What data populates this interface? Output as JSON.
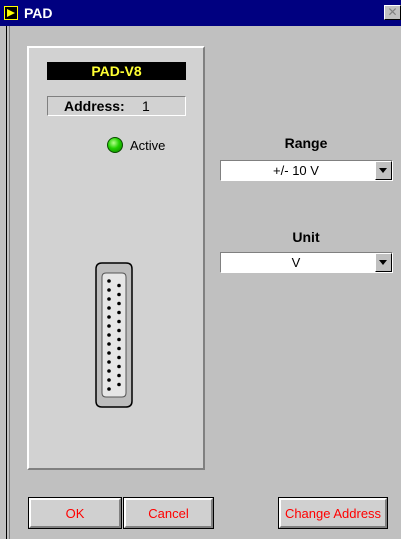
{
  "window": {
    "title": "PAD",
    "close_glyph": "✕"
  },
  "device": {
    "name": "PAD-V8",
    "address_label": "Address:",
    "address_value": "1",
    "status_label": "Active",
    "status_color": "#22d100",
    "connector_icon": "db25-connector-icon"
  },
  "range": {
    "label": "Range",
    "value": "+/- 10 V"
  },
  "unit": {
    "label": "Unit",
    "value": "V"
  },
  "buttons": {
    "ok": "OK",
    "cancel": "Cancel",
    "change_address": "Change Address"
  },
  "colors": {
    "title_bar": "#000080",
    "button_text": "#ff0000",
    "device_name_text": "#ffff33"
  }
}
